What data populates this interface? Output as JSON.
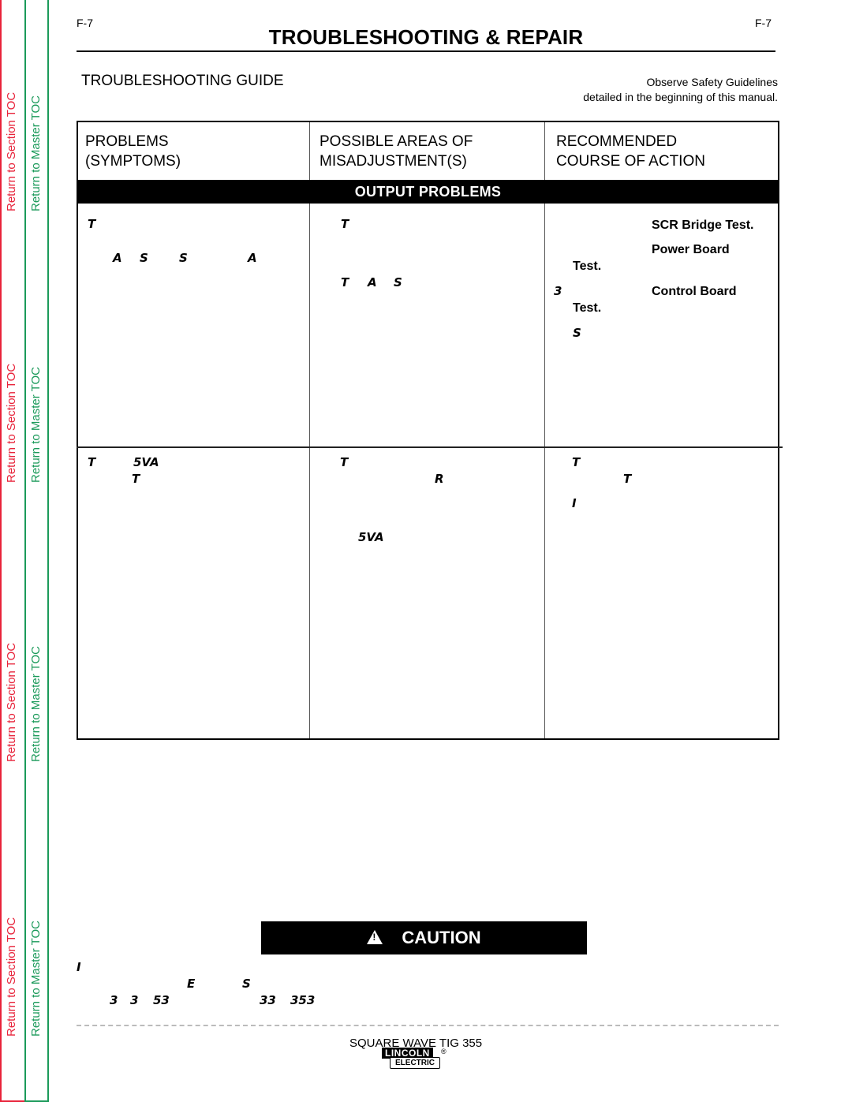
{
  "sidebar": {
    "section_toc_label": "Return to Section TOC",
    "master_toc_label": "Return to Master TOC",
    "section_toc_color": "#e8233a",
    "master_toc_color": "#1b9a5a"
  },
  "header": {
    "page_number_left": "F-7",
    "page_number_right": "F-7",
    "title": "TROUBLESHOOTING & REPAIR"
  },
  "guide": {
    "title": "TROUBLESHOOTING GUIDE",
    "safety_line1": "Observe Safety Guidelines",
    "safety_line2": "detailed in the beginning of this manual."
  },
  "table": {
    "headers": [
      {
        "line1": "PROBLEMS",
        "line2": "(SYMPTOMS)"
      },
      {
        "line1": "POSSIBLE AREAS OF",
        "line2": "MISADJUSTMENT(S)"
      },
      {
        "line1": "RECOMMENDED",
        "line2": "COURSE OF ACTION"
      }
    ],
    "section": "OUTPUT PROBLEMS",
    "rows": [
      {
        "symptoms": [
          "T",
          "A",
          "S",
          "S",
          "A"
        ],
        "areas": [
          "T",
          "T",
          "A",
          "S"
        ],
        "actions": {
          "glyphs": [
            "3",
            "S"
          ],
          "bold": [
            "SCR Bridge Test.",
            "Power Board",
            "Test.",
            "Control Board",
            "Test."
          ]
        }
      },
      {
        "symptoms": [
          "T",
          "5VA",
          "T"
        ],
        "areas": [
          "T",
          "R",
          "5VA"
        ],
        "actions": {
          "glyphs": [
            "T",
            "T",
            "I"
          ]
        }
      }
    ]
  },
  "caution": {
    "label": "CAUTION",
    "icon": "warning-triangle-icon",
    "text_glyphs": [
      "I",
      "E",
      "S",
      "3",
      "3",
      "53",
      "33",
      "353"
    ]
  },
  "footer": {
    "model": "SQUARE WAVE TIG 355",
    "brand_top": "LINCOLN",
    "brand_bottom": "ELECTRIC",
    "registered": "®"
  }
}
